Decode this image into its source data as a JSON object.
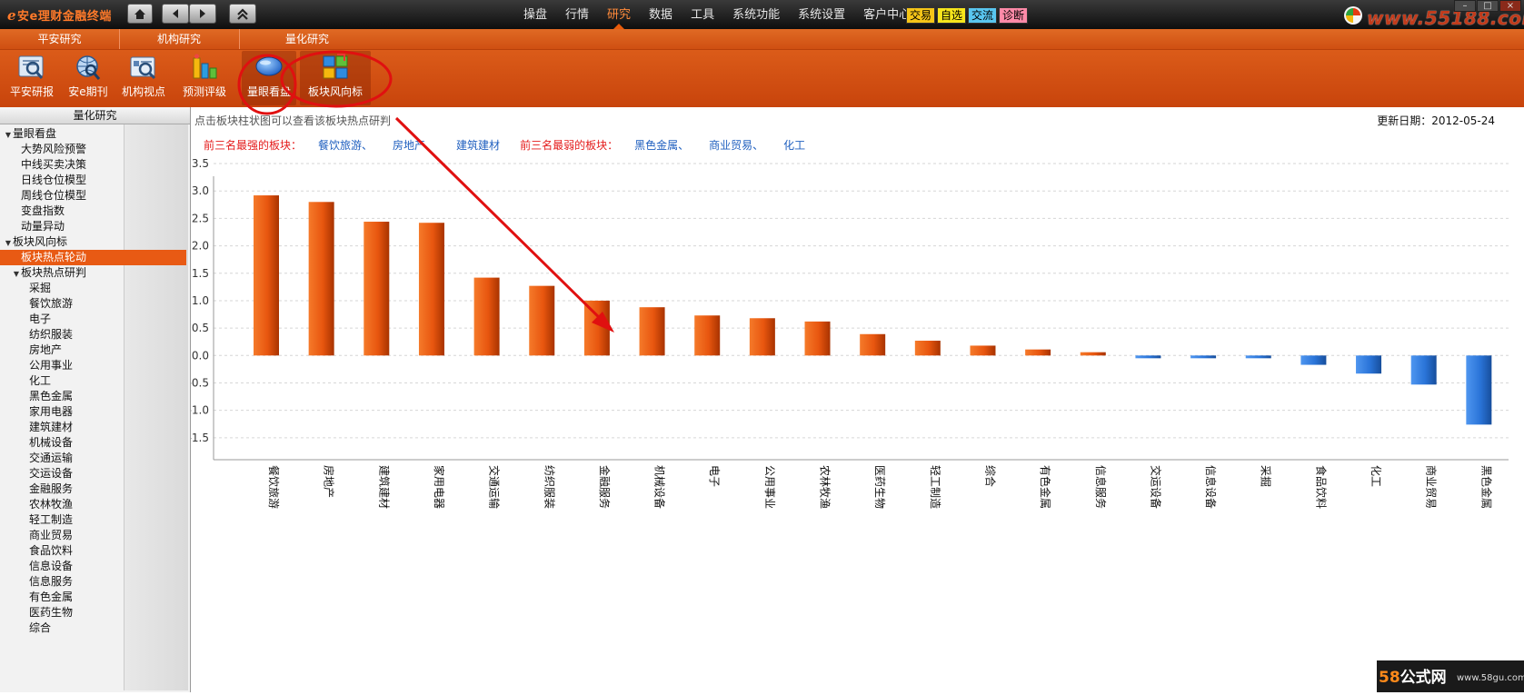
{
  "app": {
    "title": "安e理财金融终端",
    "watermark_site": "www.55188.com",
    "watermark_bottom_big": "58",
    "watermark_bottom_big2": "公式网",
    "watermark_bottom_small": "www.58gu.com"
  },
  "menu": [
    "操盘",
    "行情",
    "研究",
    "数据",
    "工具",
    "系统功能",
    "系统设置",
    "客户中心"
  ],
  "menu_active": "研究",
  "quick_buttons": [
    {
      "label": "交易",
      "color": "#f5c518"
    },
    {
      "label": "自选",
      "color": "#f7e61c"
    },
    {
      "label": "交流",
      "color": "#59c6f0"
    },
    {
      "label": "诊断",
      "color": "#ff8aa8"
    }
  ],
  "ribbon": {
    "groups": [
      "平安研究",
      "机构研究",
      "量化研究"
    ],
    "tools": [
      {
        "label": "平安研报",
        "icon": "report-magnifier-icon"
      },
      {
        "label": "安e期刊",
        "icon": "journal-globe-icon"
      },
      {
        "label": "机构视点",
        "icon": "institution-magnifier-icon"
      },
      {
        "label": "预测评级",
        "icon": "rating-bars-icon"
      },
      {
        "label": "量眼看盘",
        "icon": "eye-disc-icon"
      },
      {
        "label": "板块风向标",
        "icon": "sector-blocks-icon"
      }
    ]
  },
  "sidebar": {
    "title": "量化研究",
    "tree": [
      {
        "label": "量眼看盘",
        "level": 0,
        "toggle": "▼"
      },
      {
        "label": "大势风险预警",
        "level": 1
      },
      {
        "label": "中线买卖决策",
        "level": 1
      },
      {
        "label": "日线仓位模型",
        "level": 1
      },
      {
        "label": "周线仓位模型",
        "level": 1
      },
      {
        "label": "变盘指数",
        "level": 1
      },
      {
        "label": "动量异动",
        "level": 1
      },
      {
        "label": "板块风向标",
        "level": 0,
        "toggle": "▼"
      },
      {
        "label": "板块热点轮动",
        "level": 1,
        "selected": true
      },
      {
        "label": "板块热点研判",
        "level": 1,
        "toggle": "▼"
      },
      {
        "label": "采掘",
        "level": 2
      },
      {
        "label": "餐饮旅游",
        "level": 2
      },
      {
        "label": "电子",
        "level": 2
      },
      {
        "label": "纺织服装",
        "level": 2
      },
      {
        "label": "房地产",
        "level": 2
      },
      {
        "label": "公用事业",
        "level": 2
      },
      {
        "label": "化工",
        "level": 2
      },
      {
        "label": "黑色金属",
        "level": 2
      },
      {
        "label": "家用电器",
        "level": 2
      },
      {
        "label": "建筑建材",
        "level": 2
      },
      {
        "label": "机械设备",
        "level": 2
      },
      {
        "label": "交通运输",
        "level": 2
      },
      {
        "label": "交运设备",
        "level": 2
      },
      {
        "label": "金融服务",
        "level": 2
      },
      {
        "label": "农林牧渔",
        "level": 2
      },
      {
        "label": "轻工制造",
        "level": 2
      },
      {
        "label": "商业贸易",
        "level": 2
      },
      {
        "label": "食品饮料",
        "level": 2
      },
      {
        "label": "信息设备",
        "level": 2
      },
      {
        "label": "信息服务",
        "level": 2
      },
      {
        "label": "有色金属",
        "level": 2
      },
      {
        "label": "医药生物",
        "level": 2
      },
      {
        "label": "综合",
        "level": 2
      }
    ]
  },
  "content": {
    "hint": "点击板块柱状图可以查看该板块热点研判",
    "updated_label": "更新日期：",
    "updated_value": "2012-05-24",
    "strongest_label": "前三名最强的板块：",
    "strongest": [
      "餐饮旅游、",
      "房地产、",
      "建筑建材"
    ],
    "weakest_label": "前三名最弱的板块：",
    "weakest": [
      "黑色金属、",
      "商业贸易、",
      "化工"
    ]
  },
  "colors": {
    "positive_bar": "#e8560f",
    "negative_bar": "#2a74d8",
    "accent": "#e85a14",
    "annotation": "#e01010"
  },
  "chart_data": {
    "type": "bar",
    "categories": [
      "餐饮旅游",
      "房地产",
      "建筑建材",
      "家用电器",
      "交通运输",
      "纺织服装",
      "金融服务",
      "机械设备",
      "电子",
      "公用事业",
      "农林牧渔",
      "医药生物",
      "轻工制造",
      "综合",
      "有色金属",
      "信息服务",
      "交运设备",
      "信息设备",
      "采掘",
      "食品饮料",
      "化工",
      "商业贸易",
      "黑色金属"
    ],
    "values": [
      2.92,
      2.8,
      2.44,
      2.42,
      1.42,
      1.27,
      1.0,
      0.88,
      0.73,
      0.68,
      0.62,
      0.39,
      0.27,
      0.18,
      0.11,
      0.06,
      -0.05,
      -0.05,
      -0.05,
      -0.17,
      -0.33,
      -0.53,
      -1.26
    ],
    "yticks": [
      3.5,
      3.0,
      2.5,
      2.0,
      1.5,
      1.0,
      0.5,
      0.0,
      -0.5,
      -1.0,
      -1.5
    ],
    "ylim": [
      -1.9,
      3.6
    ],
    "grid": true,
    "title": "",
    "xlabel": "",
    "ylabel": ""
  }
}
